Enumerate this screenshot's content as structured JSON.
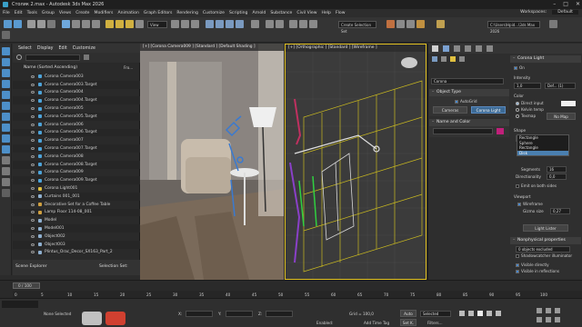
{
  "window": {
    "title": "Столик 2.max - Autodesk 3ds Max 2026",
    "controls": [
      "–",
      "□",
      "✕"
    ]
  },
  "menu": {
    "items": [
      "File",
      "Edit",
      "Tools",
      "Group",
      "Views",
      "Create",
      "Modifiers",
      "Animation",
      "Graph Editors",
      "Rendering",
      "Customize",
      "Scripting",
      "Arnold",
      "Substance",
      "Civil View",
      "Help",
      "Flow"
    ],
    "workspaces_label": "Workspaces:",
    "workspaces_value": "Default"
  },
  "toolbar": {
    "view_select": "View",
    "selection_set": "Create Selection Set",
    "path_field": "C:\\Users\\Hpid...\\3ds Max 2026"
  },
  "scene_explorer": {
    "tabs": [
      "Select",
      "Display",
      "Edit",
      "Customize"
    ],
    "column_header": "Name (Sorted Ascending)",
    "flow_label": "Fro...",
    "rows": [
      "Corona Camera003",
      "Corona Camera003.Target",
      "Corona Camera004",
      "Corona Camera004.Target",
      "Corona Camera005",
      "Corona Camera005.Target",
      "Corona Camera006",
      "Corona Camera006.Target",
      "Corona Camera007",
      "Corona Camera007.Target",
      "Corona Camera008",
      "Corona Camera008.Target",
      "Corona Camera009",
      "Corona Camera009.Target",
      "Corona Light001",
      "Curtains 001_001",
      "Decorative Set for a Coffee Table",
      "Lamp Floor 114-08_001",
      "Model",
      "Model001",
      "Object002",
      "Object003",
      "Plintus_Orac_Decor_SX163_Part_2"
    ],
    "footer_label": "Scene Explorer",
    "selection_set_label": "Selection Set:"
  },
  "viewports": {
    "left_label": "[+] [Corona Camera009 ] [Standard ] [Default Shading ]",
    "right_label": "[+] [Orthographic ] [Standard ] [Wireframe ]"
  },
  "command_panel": {
    "object_type_header": "Object Type",
    "autogrid": "AutoGrid",
    "btn_cameras": "Cameras",
    "btn_corona_light": "Corona Light",
    "name_color_header": "Name and Color",
    "name_value": "Corona",
    "params_header": "Corona Light",
    "on_label": "On",
    "intensity_label": "Intensity",
    "intensity_value": "1,0",
    "intensity_unit": "Def... (1)",
    "color_label": "Color",
    "direct_input": "Direct input",
    "kelvin_temp": "Kelvin temp",
    "texmap": "Texmap",
    "texmap_value": "No Map",
    "shape_label": "Shape",
    "shape_value": "Rectangle",
    "shape_options": [
      "Rectangle",
      "Sphere",
      "Rectangle",
      "Disk"
    ],
    "segments_label": "Segments",
    "segments_value": "16",
    "directionality_label": "Directionality",
    "directionality_value": "0,0",
    "emit_both": "Emit on both sides",
    "viewport_label": "Viewport",
    "wireframe_label": "Wireframe",
    "icon_size_label": "Gizmo size",
    "icon_size_value": "0,27",
    "light_lister": "Light Lister",
    "nonphysical_header": "Nonphysical properties",
    "excluded": "0 objects excluded",
    "shadowcatcher": "Shadowcatcher illuminator",
    "visible_directly": "Visible directly",
    "visible_reflections": "Visible in reflections",
    "visible_refractions": "Visible in refractions"
  },
  "timeline": {
    "frame_display": "0 / 100",
    "ticks": [
      "0",
      "5",
      "10",
      "15",
      "20",
      "25",
      "30",
      "35",
      "40",
      "45",
      "50",
      "55",
      "60",
      "65",
      "70",
      "75",
      "80",
      "85",
      "90",
      "95",
      "100"
    ]
  },
  "status": {
    "message": "None Selected",
    "x_label": "X:",
    "y_label": "Y:",
    "z_label": "Z:",
    "grid": "Grid = 100,0",
    "enabled": "Enabled:",
    "add_time_tag": "Add Time Tag",
    "auto": "Auto",
    "selected": "Selected",
    "set_key": "Set K.",
    "filters": "Filters..."
  },
  "colors": {
    "accent": "#4a8ad0",
    "selection_yellow": "#e0c020",
    "viewport_bg": "#3a3a3a"
  }
}
